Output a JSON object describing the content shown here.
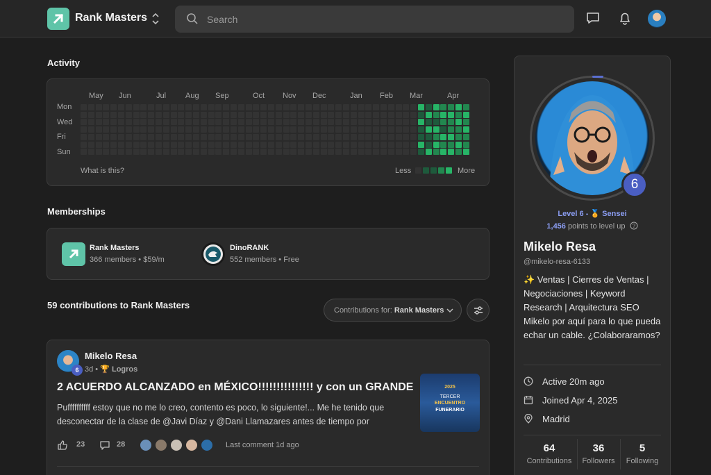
{
  "header": {
    "brand": "Rank Masters",
    "search_placeholder": "Search",
    "icons": [
      "chat-icon",
      "bell-icon"
    ]
  },
  "activity": {
    "title": "Activity",
    "months": [
      "May",
      "Jun",
      "Jul",
      "Aug",
      "Sep",
      "Oct",
      "Nov",
      "Dec",
      "Jan",
      "Feb",
      "Mar",
      "Apr"
    ],
    "days": [
      "Mon",
      "Wed",
      "Fri",
      "Sun"
    ],
    "help": "What is this?",
    "legend_less": "Less",
    "legend_more": "More",
    "colors": {
      "empty": "#333333",
      "l1": "#1e5a3c",
      "l2": "#22874f",
      "l3": "#27b567"
    }
  },
  "memberships": {
    "title": "Memberships",
    "items": [
      {
        "name": "Rank Masters",
        "meta": "366 members • $59/m"
      },
      {
        "name": "DinoRANK",
        "meta": "552 members • Free"
      }
    ]
  },
  "contributions": {
    "count_label": "59 contributions to Rank Masters",
    "filter_prefix": "Contributions for: ",
    "filter_value": "Rank Masters"
  },
  "post": {
    "author": "Mikelo Resa",
    "level": "6",
    "time": "3d",
    "category": "Logros",
    "title": "2 ACUERDO ALCANZADO en MÉXICO!!!!!!!!!!!!!!! y con un GRANDE",
    "body": "Puffffffffff estoy que no me lo creo, contento es poco, lo siguiente!... Me he tenido que desconectar de la clase de @Javi Díaz y @Dani Llamazares antes de tiempo por",
    "likes": "23",
    "comments": "28",
    "last_comment": "Last comment 1d ago",
    "thumb": {
      "year": "2025",
      "line1": "TERCER",
      "line2": "ENCUENTRO",
      "line3": "FUNERARIO"
    }
  },
  "profile": {
    "level_badge": "6",
    "level_text": "Level 6 - 🏅 Sensei",
    "points": "1,456",
    "points_suffix": " points to level up",
    "name": "Mikelo Resa",
    "handle": "@mikelo-resa-6133",
    "bio": "✨ Ventas | Cierres de Ventas | Negociaciones | Keyword Research | Arquitectura SEO Mikelo por aquí para lo que pueda echar un cable. ¿Colaboraramos?",
    "active": "Active 20m ago",
    "joined": "Joined Apr 4, 2025",
    "location": "Madrid",
    "stats": [
      {
        "num": "64",
        "label": "Contributions"
      },
      {
        "num": "36",
        "label": "Followers"
      },
      {
        "num": "5",
        "label": "Following"
      }
    ]
  }
}
